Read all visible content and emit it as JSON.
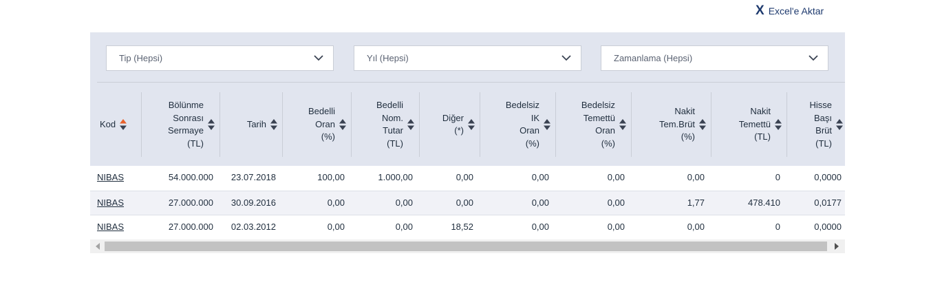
{
  "export": {
    "icon": "excel-x-icon",
    "icon_glyph": "X",
    "label": "Excel'e Aktar"
  },
  "filters": [
    {
      "placeholder": "Tip (Hepsi)"
    },
    {
      "placeholder": "Yıl (Hepsi)"
    },
    {
      "placeholder": "Zamanlama (Hepsi)"
    }
  ],
  "columns": [
    {
      "label": "Kod",
      "sort": "active"
    },
    {
      "label": "Bölünme Sonrası Sermaye (TL)",
      "sort": "none"
    },
    {
      "label": "Tarih",
      "sort": "none"
    },
    {
      "label": "Bedelli Oran (%)",
      "sort": "none"
    },
    {
      "label": "Bedelli Nom. Tutar (TL)",
      "sort": "none"
    },
    {
      "label": "Diğer (*)",
      "sort": "none"
    },
    {
      "label": "Bedelsiz IK Oran (%)",
      "sort": "none"
    },
    {
      "label": "Bedelsiz Temettü Oran (%)",
      "sort": "none"
    },
    {
      "label": "Nakit Tem.Brüt (%)",
      "sort": "none"
    },
    {
      "label": "Nakit Temettü (TL)",
      "sort": "none"
    },
    {
      "label": "Hisse Başı Brüt (TL)",
      "sort": "none"
    }
  ],
  "rows": [
    {
      "cells": [
        "NIBAS",
        "54.000.000",
        "23.07.2018",
        "100,00",
        "1.000,00",
        "0,00",
        "0,00",
        "0,00",
        "0,00",
        "0",
        "0,0000"
      ]
    },
    {
      "cells": [
        "NIBAS",
        "27.000.000",
        "30.09.2016",
        "0,00",
        "0,00",
        "0,00",
        "0,00",
        "0,00",
        "1,77",
        "478.410",
        "0,0177"
      ]
    },
    {
      "cells": [
        "NIBAS",
        "27.000.000",
        "02.03.2012",
        "0,00",
        "0,00",
        "18,52",
        "0,00",
        "0,00",
        "0,00",
        "0",
        "0,0000"
      ]
    }
  ],
  "colors": {
    "panel": "#e1e5ef",
    "accent": "#1e3a6e",
    "sort_active_up": "#e8612c",
    "sort_inactive": "#3a4252"
  }
}
